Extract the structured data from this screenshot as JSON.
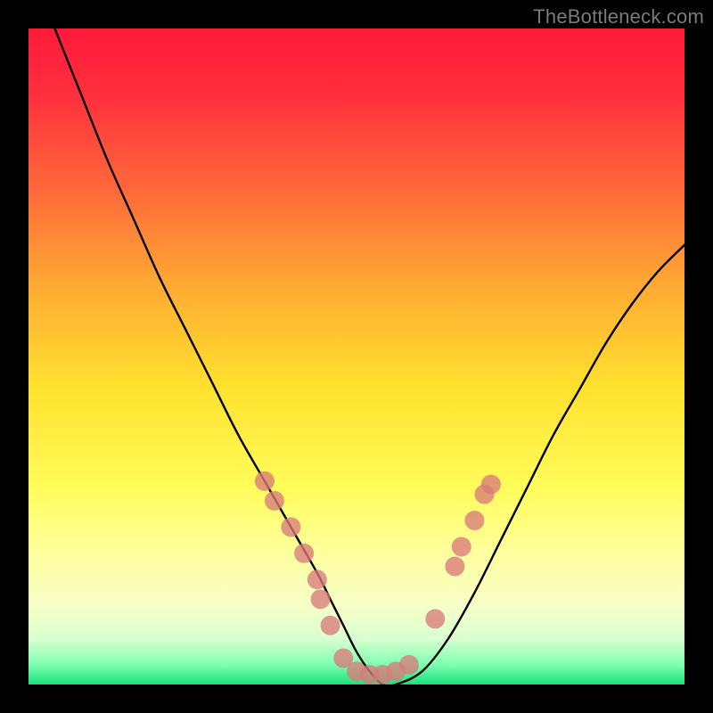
{
  "watermark": "TheBottleneck.com",
  "chart_data": {
    "type": "line",
    "title": "",
    "xlabel": "",
    "ylabel": "",
    "xlim": [
      0,
      100
    ],
    "ylim": [
      0,
      100
    ],
    "gradient_stops": [
      {
        "offset": 0.0,
        "color": "#ff1a3a"
      },
      {
        "offset": 0.1,
        "color": "#ff2f3d"
      },
      {
        "offset": 0.25,
        "color": "#ff6a3a"
      },
      {
        "offset": 0.4,
        "color": "#ffad33"
      },
      {
        "offset": 0.55,
        "color": "#ffe22e"
      },
      {
        "offset": 0.7,
        "color": "#fffc5a"
      },
      {
        "offset": 0.8,
        "color": "#ffff9e"
      },
      {
        "offset": 0.88,
        "color": "#f7ffc8"
      },
      {
        "offset": 0.93,
        "color": "#d9ffd0"
      },
      {
        "offset": 0.97,
        "color": "#7effb0"
      },
      {
        "offset": 1.0,
        "color": "#18e07e"
      }
    ],
    "series": [
      {
        "name": "bottleneck-curve",
        "x": [
          4,
          8,
          12,
          16,
          20,
          24,
          28,
          32,
          36,
          40,
          44,
          46,
          48,
          50,
          52,
          54,
          56,
          60,
          64,
          68,
          72,
          76,
          80,
          84,
          88,
          92,
          96,
          100
        ],
        "y": [
          100,
          90,
          80,
          71,
          62,
          54,
          46,
          38,
          31,
          24,
          17,
          13,
          9,
          5,
          2,
          0,
          0,
          2,
          7,
          14,
          22,
          30,
          38,
          45,
          52,
          58,
          63,
          67
        ]
      }
    ],
    "markers": {
      "name": "highlight-dots",
      "color": "#d97b7b",
      "radius": 11,
      "points": [
        {
          "x": 36,
          "y": 31
        },
        {
          "x": 37.5,
          "y": 28
        },
        {
          "x": 40,
          "y": 24
        },
        {
          "x": 42,
          "y": 20
        },
        {
          "x": 44,
          "y": 16
        },
        {
          "x": 44.5,
          "y": 13
        },
        {
          "x": 46,
          "y": 9
        },
        {
          "x": 48,
          "y": 4
        },
        {
          "x": 50,
          "y": 2
        },
        {
          "x": 52,
          "y": 1.5
        },
        {
          "x": 54,
          "y": 1.5
        },
        {
          "x": 56,
          "y": 2
        },
        {
          "x": 58,
          "y": 3
        },
        {
          "x": 62,
          "y": 10
        },
        {
          "x": 65,
          "y": 18
        },
        {
          "x": 66,
          "y": 21
        },
        {
          "x": 68,
          "y": 25
        },
        {
          "x": 69.5,
          "y": 29
        },
        {
          "x": 70.5,
          "y": 30.5
        }
      ]
    }
  }
}
